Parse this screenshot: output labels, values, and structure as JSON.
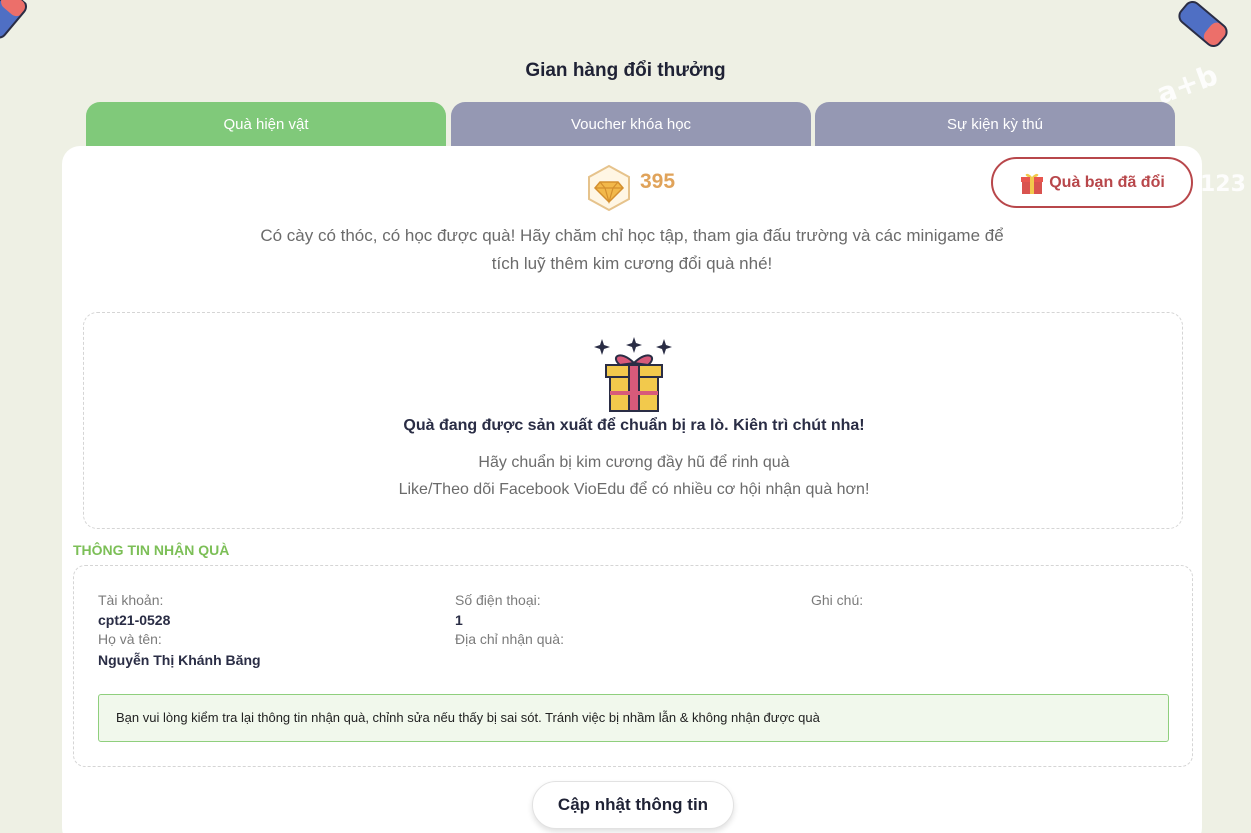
{
  "header": {
    "title": "Gian hàng đổi thưởng"
  },
  "tabs": [
    {
      "label": "Quà hiện vật",
      "active": true
    },
    {
      "label": "Voucher khóa học",
      "active": false
    },
    {
      "label": "Sự kiện kỳ thú",
      "active": false
    }
  ],
  "balance": {
    "diamonds": "395",
    "icon": "diamond-icon"
  },
  "redeemed_button": {
    "label": "Quà bạn đã đổi",
    "icon": "gift-icon"
  },
  "intro": {
    "line1": "Có cày có thóc, có học được quà! Hãy chăm chỉ học tập, tham gia đấu trường và các minigame để",
    "line2": "tích luỹ thêm kim cương đổi quà nhé!"
  },
  "empty_state": {
    "title": "Quà đang được sản xuất để chuẩn bị ra lò. Kiên trì chút nha!",
    "line1": "Hãy chuẩn bị kim cương đầy hũ để rinh quà",
    "line2": "Like/Theo dõi Facebook VioEdu để có nhiều cơ hội nhận quà hơn!"
  },
  "recipient_info": {
    "section_title": "THÔNG TIN NHẬN QUÀ",
    "account_label": "Tài khoản:",
    "account_value": "cpt21-0528",
    "fullname_label": "Họ và tên:",
    "fullname_value": "Nguyễn Thị Khánh Băng",
    "phone_label": "Số điện thoại:",
    "phone_value": "1",
    "address_label": "Địa chỉ nhận quà:",
    "note_label": "Ghi chú:",
    "notice": "Bạn vui lòng kiểm tra lại thông tin nhận quà, chỉnh sửa nếu thấy bị sai sót. Tránh việc bị nhầm lẫn & không nhận được quà"
  },
  "update_button": {
    "label": "Cập nhật thông tin"
  },
  "decor": {
    "math_1": "a+b",
    "math_2": "123"
  },
  "colors": {
    "active_tab": "#80c97a",
    "inactive_tab": "#9598b3",
    "accent_red": "#b8474b",
    "diamond_gold": "#e0a35a",
    "section_green": "#7cbf57"
  }
}
